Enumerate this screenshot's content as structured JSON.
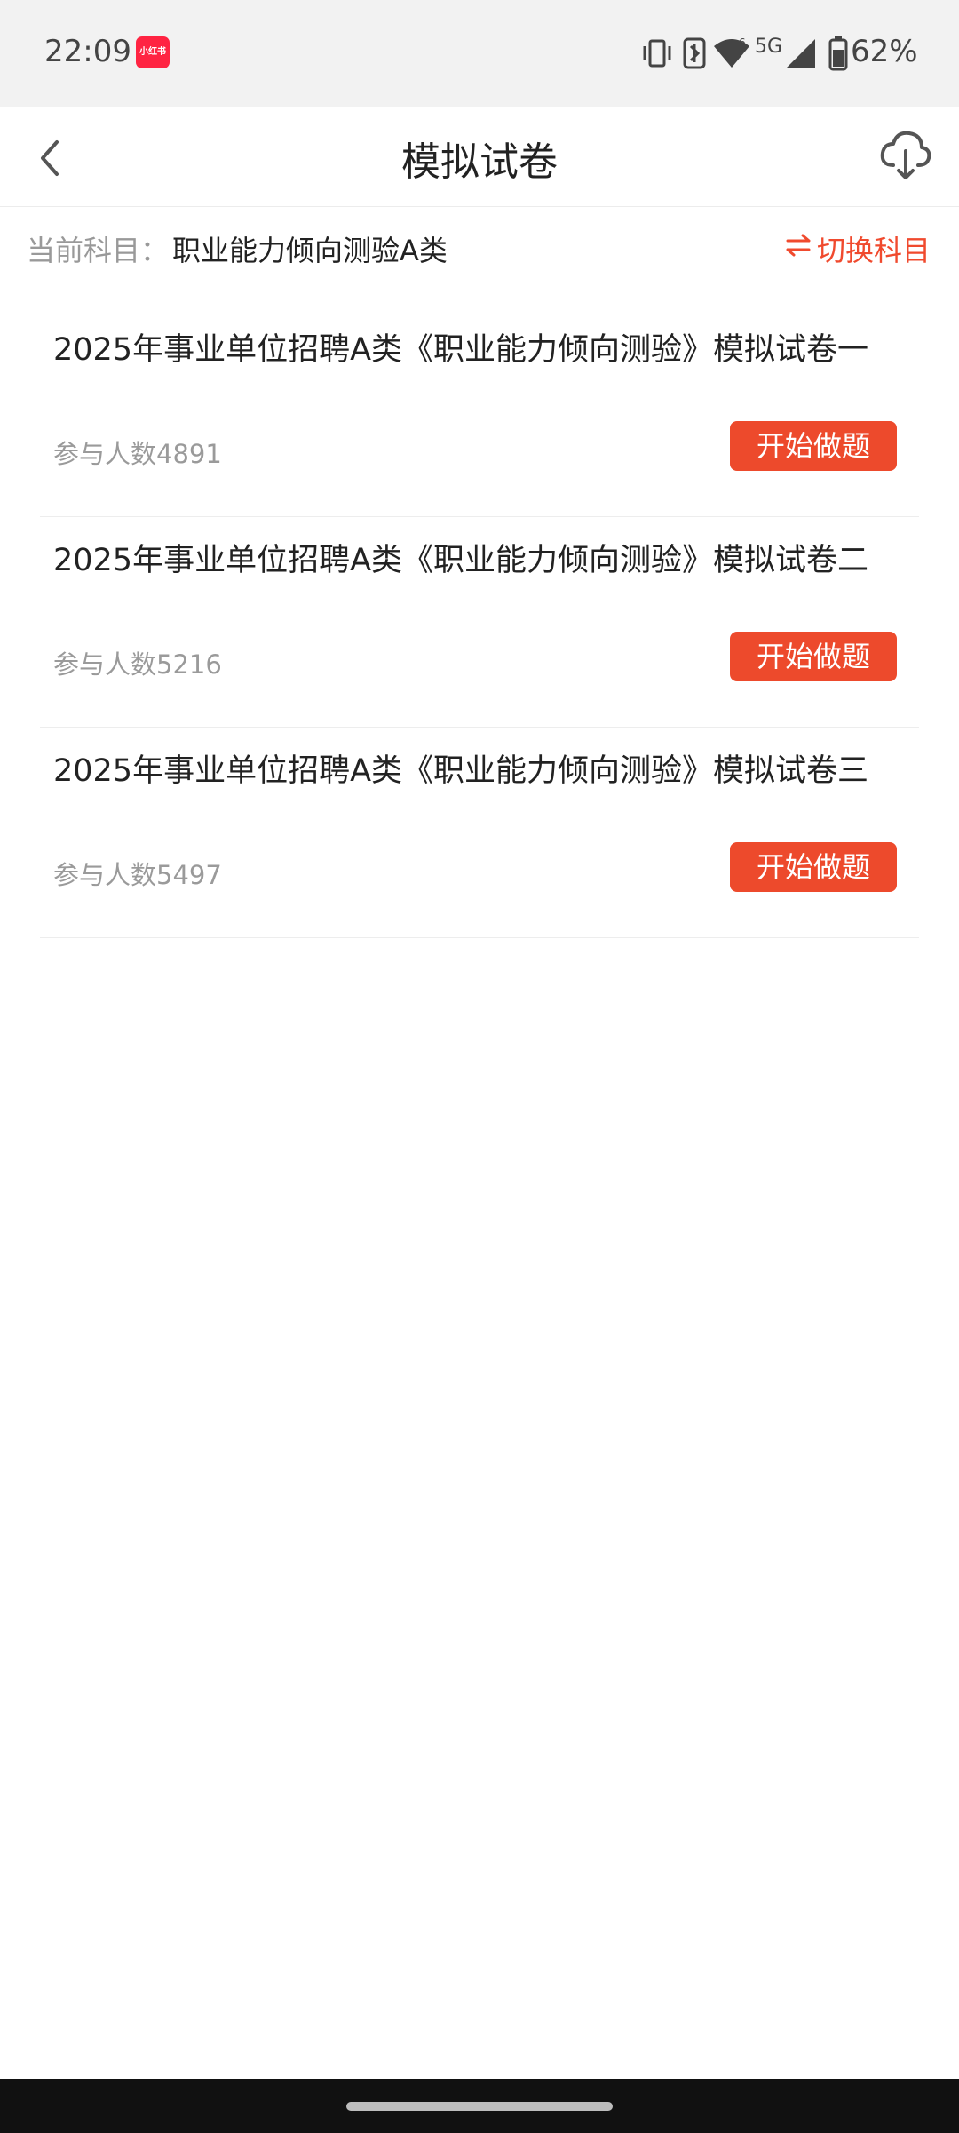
{
  "status_bar": {
    "time": "22:09",
    "app_badge_text": "小红书",
    "network": "5G",
    "battery": "62%",
    "icons": [
      "vibrate-icon",
      "nfc-icon",
      "wifi-icon",
      "signal-icon",
      "battery-icon"
    ]
  },
  "header": {
    "title": "模拟试卷",
    "back_icon": "chevron-left-icon",
    "download_icon": "cloud-download-icon"
  },
  "subject": {
    "label": "当前科目：",
    "value": "职业能力倾向测验A类",
    "switch_label": "切换科目",
    "switch_icon": "swap-arrows-icon",
    "accent_color": "#f04a2e"
  },
  "exams": [
    {
      "title": "2025年事业单位招聘A类《职业能力倾向测验》模拟试卷一",
      "count": "参与人数4891",
      "button": "开始做题"
    },
    {
      "title": "2025年事业单位招聘A类《职业能力倾向测验》模拟试卷二",
      "count": "参与人数5216",
      "button": "开始做题"
    },
    {
      "title": "2025年事业单位招聘A类《职业能力倾向测验》模拟试卷三",
      "count": "参与人数5497",
      "button": "开始做题"
    }
  ],
  "colors": {
    "button_bg": "#ed4a2c",
    "status_bar_bg": "#f2f2f2"
  }
}
